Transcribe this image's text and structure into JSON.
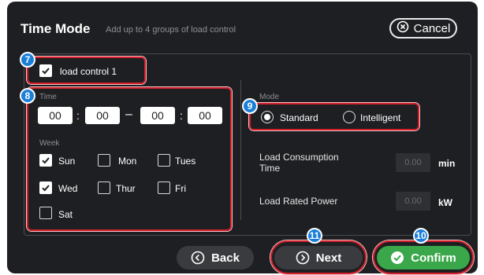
{
  "header": {
    "title": "Time Mode",
    "subtitle": "Add up to 4 groups of load control",
    "cancel_label": "Cancel"
  },
  "load_control": {
    "label": "load control 1",
    "checked": true
  },
  "time": {
    "label": "Time",
    "start_hour": "00",
    "start_minute": "00",
    "range_separator": "–",
    "end_hour": "00",
    "end_minute": "00",
    "colon": ":"
  },
  "week": {
    "label": "Week",
    "days": [
      {
        "label": "Sun",
        "checked": true
      },
      {
        "label": "Mon",
        "checked": false
      },
      {
        "label": "Tues",
        "checked": false
      },
      {
        "label": "Wed",
        "checked": true
      },
      {
        "label": "Thur",
        "checked": false
      },
      {
        "label": "Fri",
        "checked": false
      },
      {
        "label": "Sat",
        "checked": false
      }
    ]
  },
  "mode": {
    "label": "Mode",
    "options": [
      {
        "label": "Standard",
        "selected": true
      },
      {
        "label": "Intelligent",
        "selected": false
      }
    ]
  },
  "load_consumption": {
    "label": "Load Consumption Time",
    "placeholder": "0.00",
    "unit": "min"
  },
  "load_rated_power": {
    "label": "Load Rated Power",
    "placeholder": "0.00",
    "unit": "kW"
  },
  "footer": {
    "back_label": "Back",
    "next_label": "Next",
    "confirm_label": "Confirm"
  },
  "annotations": {
    "badge_7": "7",
    "badge_8": "8",
    "badge_9": "9",
    "badge_10": "10",
    "badge_11": "11"
  },
  "colors": {
    "panel_bg": "#1e1f22",
    "highlight_red": "#d21f2a",
    "badge_blue": "#1a7fd8",
    "confirm_green": "#3aa84a",
    "button_gray": "#3a3b3f"
  }
}
